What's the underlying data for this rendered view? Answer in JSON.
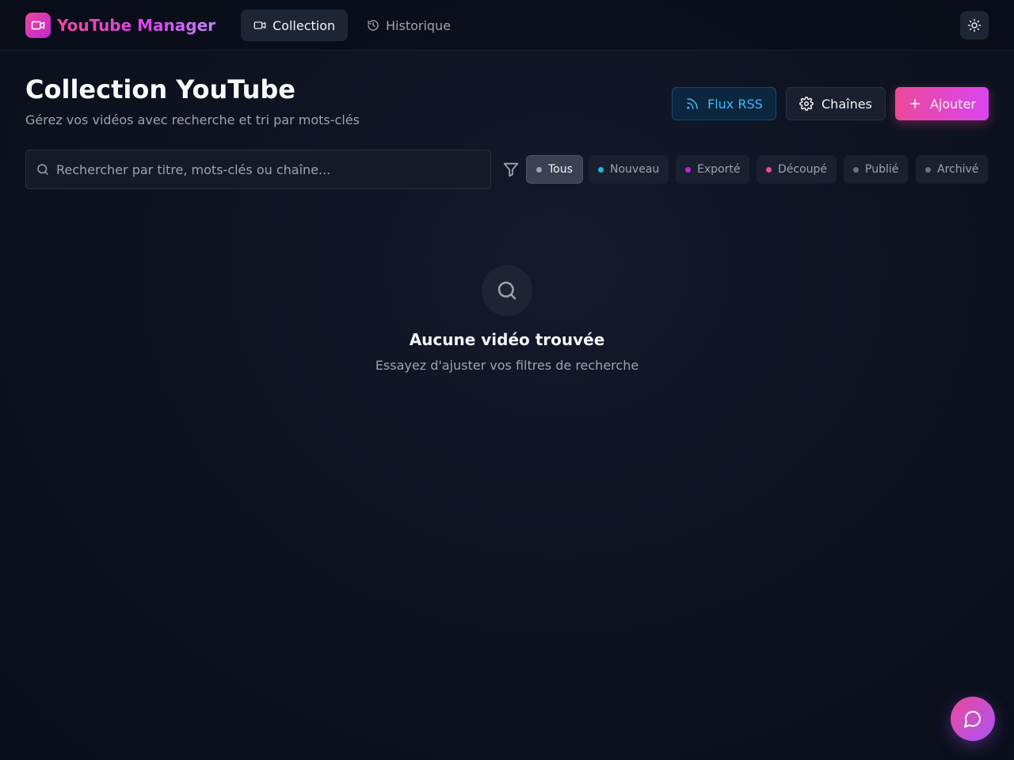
{
  "app": {
    "name": "YouTube Manager",
    "logo_icon": "video-camera-icon"
  },
  "nav": {
    "tabs": [
      {
        "label": "Collection",
        "icon": "video-camera-icon",
        "active": true
      },
      {
        "label": "Historique",
        "icon": "history-icon",
        "active": false
      }
    ],
    "theme_toggle_icon": "sun-icon"
  },
  "header": {
    "title": "Collection YouTube",
    "subtitle": "Gérez vos vidéos avec recherche et tri par mots-clés",
    "buttons": {
      "rss": {
        "label": "Flux RSS",
        "icon": "rss-icon"
      },
      "channels": {
        "label": "Chaînes",
        "icon": "gear-icon"
      },
      "add": {
        "label": "Ajouter",
        "icon": "plus-icon"
      }
    }
  },
  "search": {
    "placeholder": "Rechercher par titre, mots-clés ou chaîne...",
    "value": ""
  },
  "filters": {
    "icon": "filter-icon",
    "chips": [
      {
        "label": "Tous",
        "dot_color": "#9ca3af",
        "active": true
      },
      {
        "label": "Nouveau",
        "dot_color": "#22b8e6",
        "active": false
      },
      {
        "label": "Exporté",
        "dot_color": "#c026d3",
        "active": false
      },
      {
        "label": "Découpé",
        "dot_color": "#ec4899",
        "active": false
      },
      {
        "label": "Publié",
        "dot_color": "#6b7280",
        "active": false
      },
      {
        "label": "Archivé",
        "dot_color": "#6b7280",
        "active": false
      }
    ]
  },
  "empty_state": {
    "icon": "search-icon",
    "title": "Aucune vidéo trouvée",
    "message": "Essayez d'ajuster vos filtres de recherche"
  },
  "fab": {
    "icon": "chat-bubble-icon"
  },
  "colors": {
    "accent_pink": "#ec4899",
    "accent_purple": "#d946ef",
    "rss_blue": "#38bdf8",
    "background": "#0e1322"
  }
}
